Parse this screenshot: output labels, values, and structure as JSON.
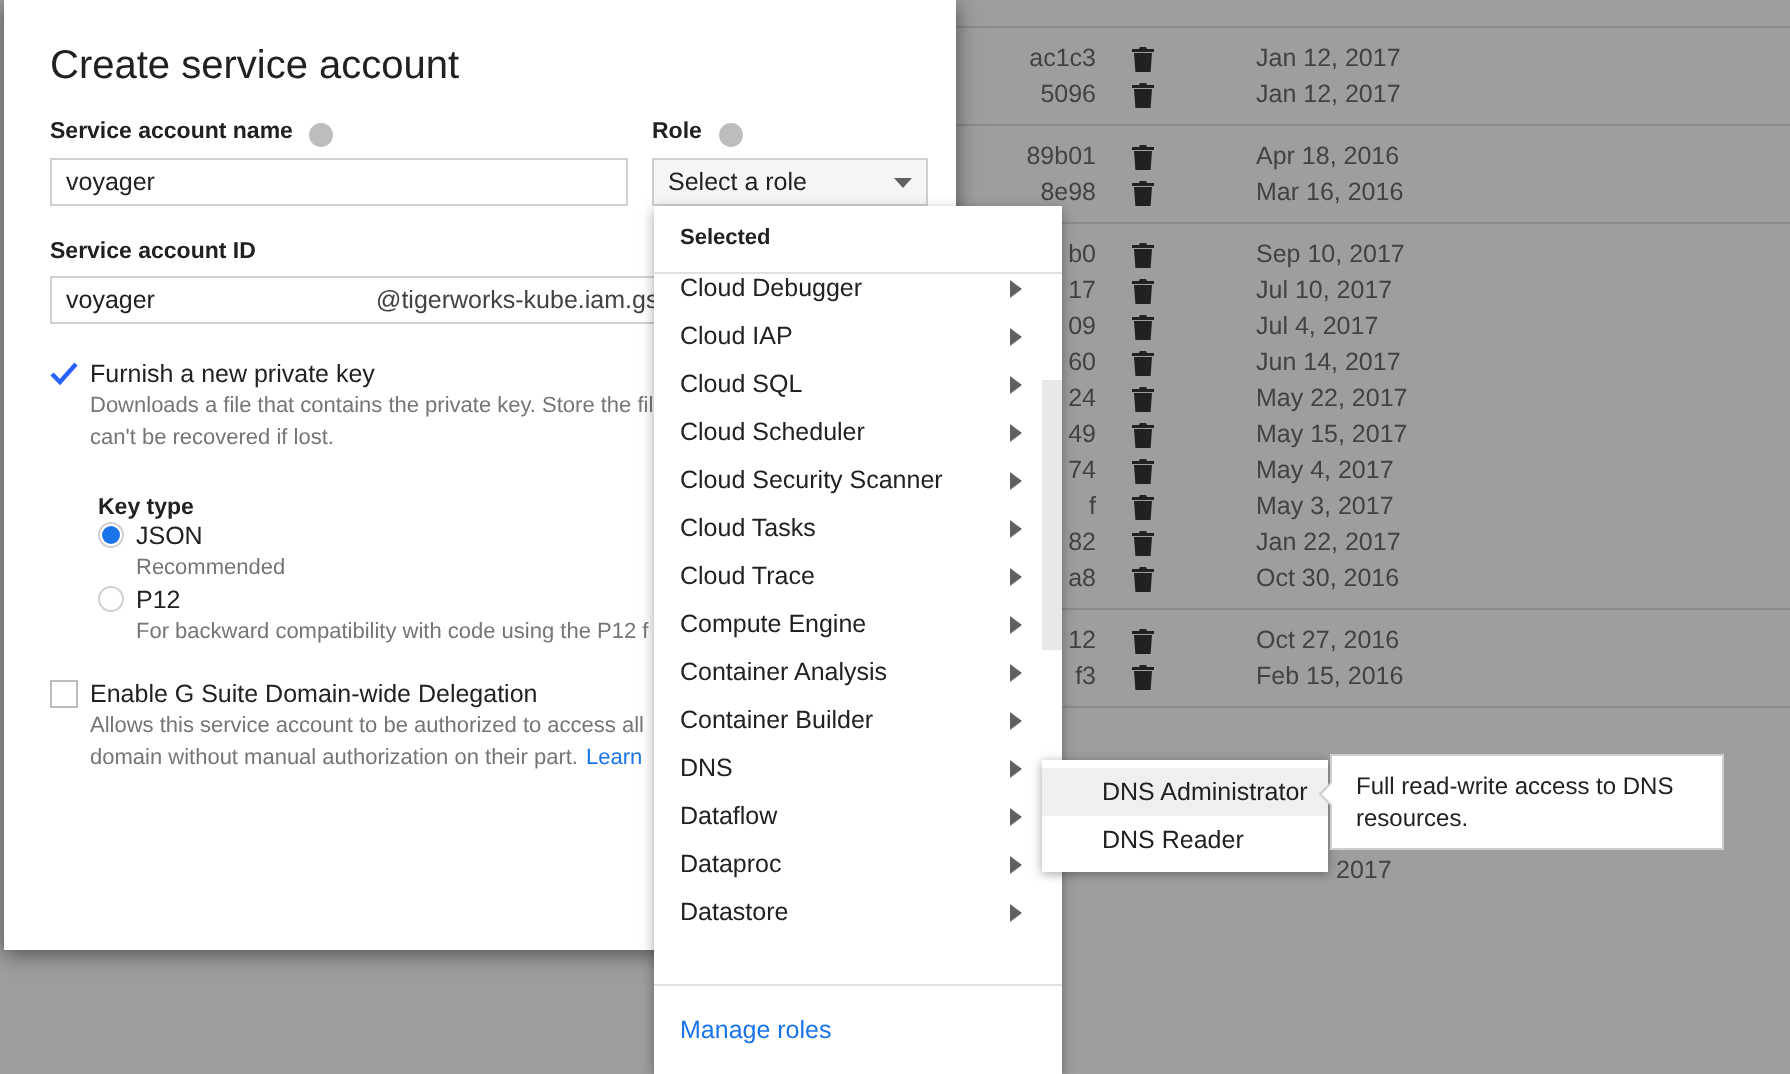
{
  "background_table": {
    "groups": [
      {
        "rows": [
          {
            "key": "ac1c3",
            "date": "Jan 12, 2017"
          },
          {
            "key": "5096",
            "date": "Jan 12, 2017"
          }
        ]
      },
      {
        "rows": [
          {
            "key": "89b01",
            "date": "Apr 18, 2016"
          },
          {
            "key": "8e98",
            "date": "Mar 16, 2016"
          }
        ]
      },
      {
        "rows": [
          {
            "key": "b0",
            "date": "Sep 10, 2017"
          },
          {
            "key": "17",
            "date": "Jul 10, 2017"
          },
          {
            "key": "09",
            "date": "Jul 4, 2017"
          },
          {
            "key": "60",
            "date": "Jun 14, 2017"
          },
          {
            "key": "24",
            "date": "May 22, 2017"
          },
          {
            "key": "49",
            "date": "May 15, 2017"
          },
          {
            "key": "74",
            "date": "May 4, 2017"
          },
          {
            "key": "f",
            "date": "May 3, 2017"
          },
          {
            "key": "82",
            "date": "Jan 22, 2017"
          },
          {
            "key": "a8",
            "date": "Oct 30, 2016"
          }
        ]
      },
      {
        "rows": [
          {
            "key": "12",
            "date": "Oct 27, 2016"
          },
          {
            "key": "f3",
            "date": "Feb 15, 2016"
          }
        ]
      }
    ],
    "trailing_date": "2017"
  },
  "dialog": {
    "title": "Create service account",
    "name_label": "Service account name",
    "name_value": "voyager",
    "role_label": "Role",
    "role_select": "Select a role",
    "id_label": "Service account ID",
    "id_value": "voyager",
    "id_suffix": "@tigerworks-kube.iam.gs",
    "private_key": {
      "label": "Furnish a new private key",
      "checked": true,
      "description": [
        "Downloads a file that contains the private key. Store the fil",
        "can't be recovered if lost."
      ]
    },
    "key_type": {
      "label": "Key type",
      "options": [
        {
          "label": "JSON",
          "hint": "Recommended",
          "selected": true
        },
        {
          "label": "P12",
          "hint": "For backward compatibility with code using the P12 f",
          "selected": false
        }
      ]
    },
    "delegation": {
      "label": "Enable G Suite Domain-wide Delegation",
      "checked": false,
      "description": [
        "Allows this service account to be authorized to access all",
        "domain without manual authorization on their part."
      ],
      "link": "Learn"
    }
  },
  "role_menu": {
    "header": "Selected",
    "items": [
      {
        "label": "Cloud Debugger"
      },
      {
        "label": "Cloud IAP"
      },
      {
        "label": "Cloud SQL"
      },
      {
        "label": "Cloud Scheduler"
      },
      {
        "label": "Cloud Security Scanner"
      },
      {
        "label": "Cloud Tasks"
      },
      {
        "label": "Cloud Trace"
      },
      {
        "label": "Compute Engine"
      },
      {
        "label": "Container Analysis"
      },
      {
        "label": "Container Builder"
      },
      {
        "label": "DNS",
        "children": [
          {
            "label": "DNS Administrator",
            "selected": true
          },
          {
            "label": "DNS Reader",
            "selected": false
          }
        ]
      },
      {
        "label": "Dataflow"
      },
      {
        "label": "Dataproc"
      },
      {
        "label": "Datastore"
      }
    ],
    "footer_link": "Manage roles"
  },
  "tooltip": "Full read-write access to DNS resources."
}
